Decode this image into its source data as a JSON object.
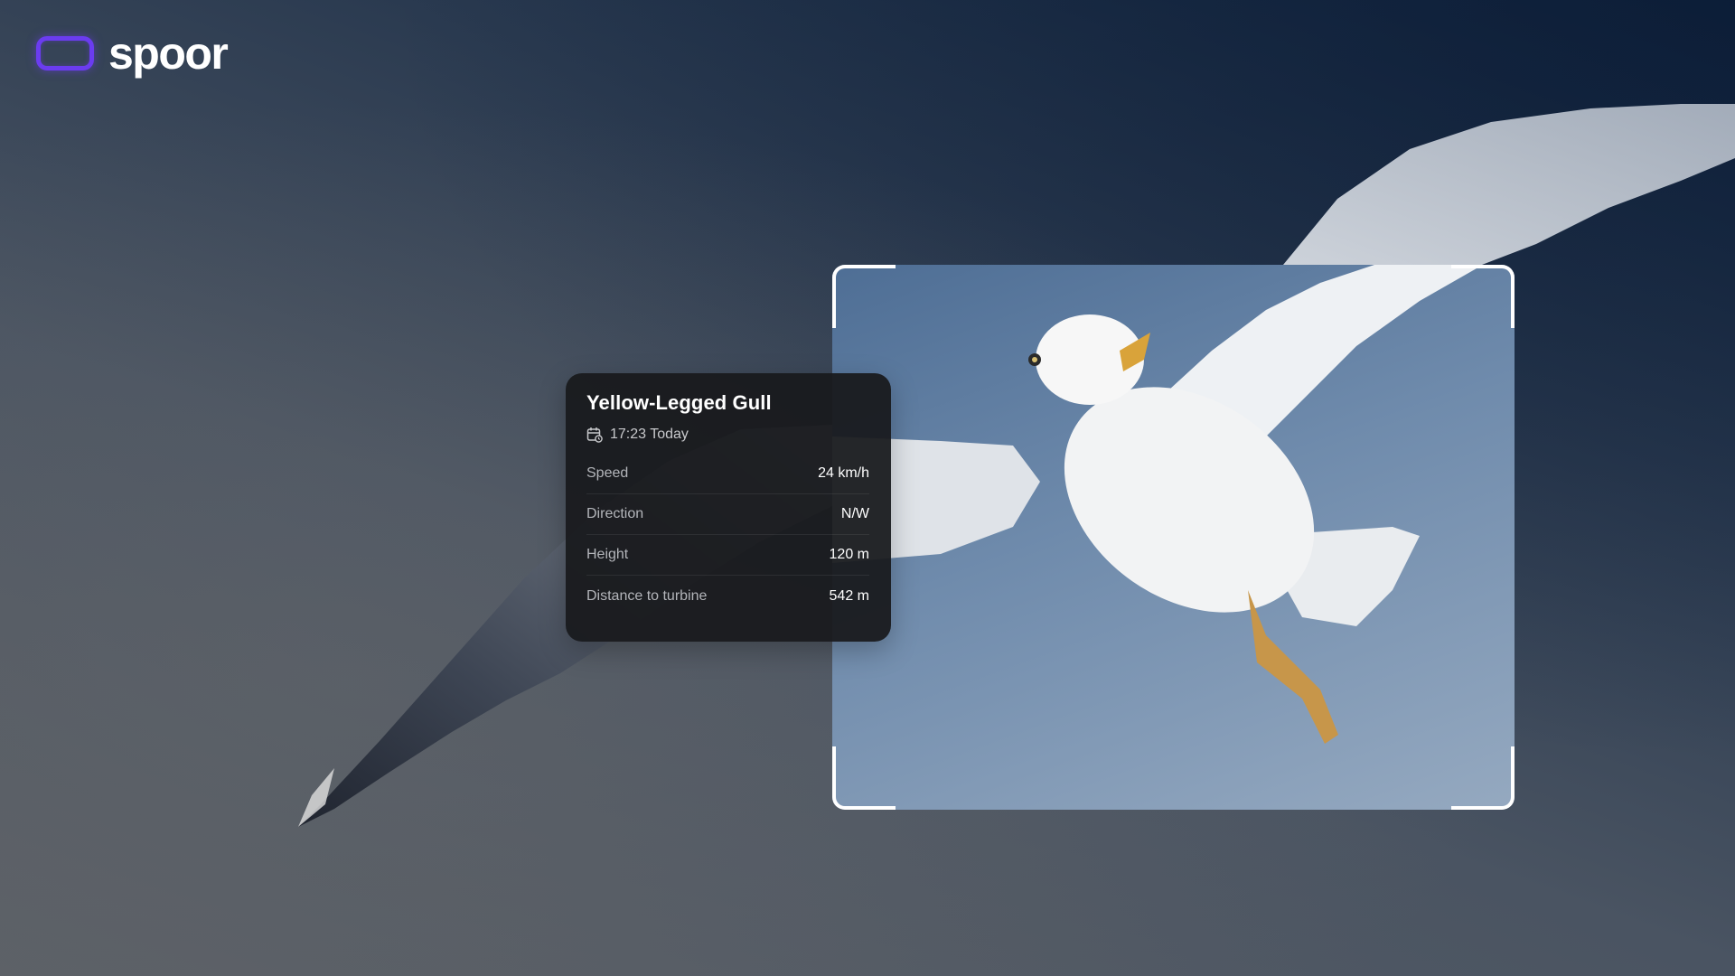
{
  "brand": {
    "name": "spoor",
    "accent_color": "#6b3cf0",
    "icon": "rounded-rect-logo-icon"
  },
  "detection": {
    "species": "Yellow-Legged Gull",
    "time_icon": "calendar-clock-icon",
    "time": "17:23 Today",
    "stats": [
      {
        "label": "Speed",
        "value": "24 km/h"
      },
      {
        "label": "Direction",
        "value": "N/W"
      },
      {
        "label": "Height",
        "value": "120 m"
      },
      {
        "label": "Distance to turbine",
        "value": "542 m"
      }
    ]
  }
}
